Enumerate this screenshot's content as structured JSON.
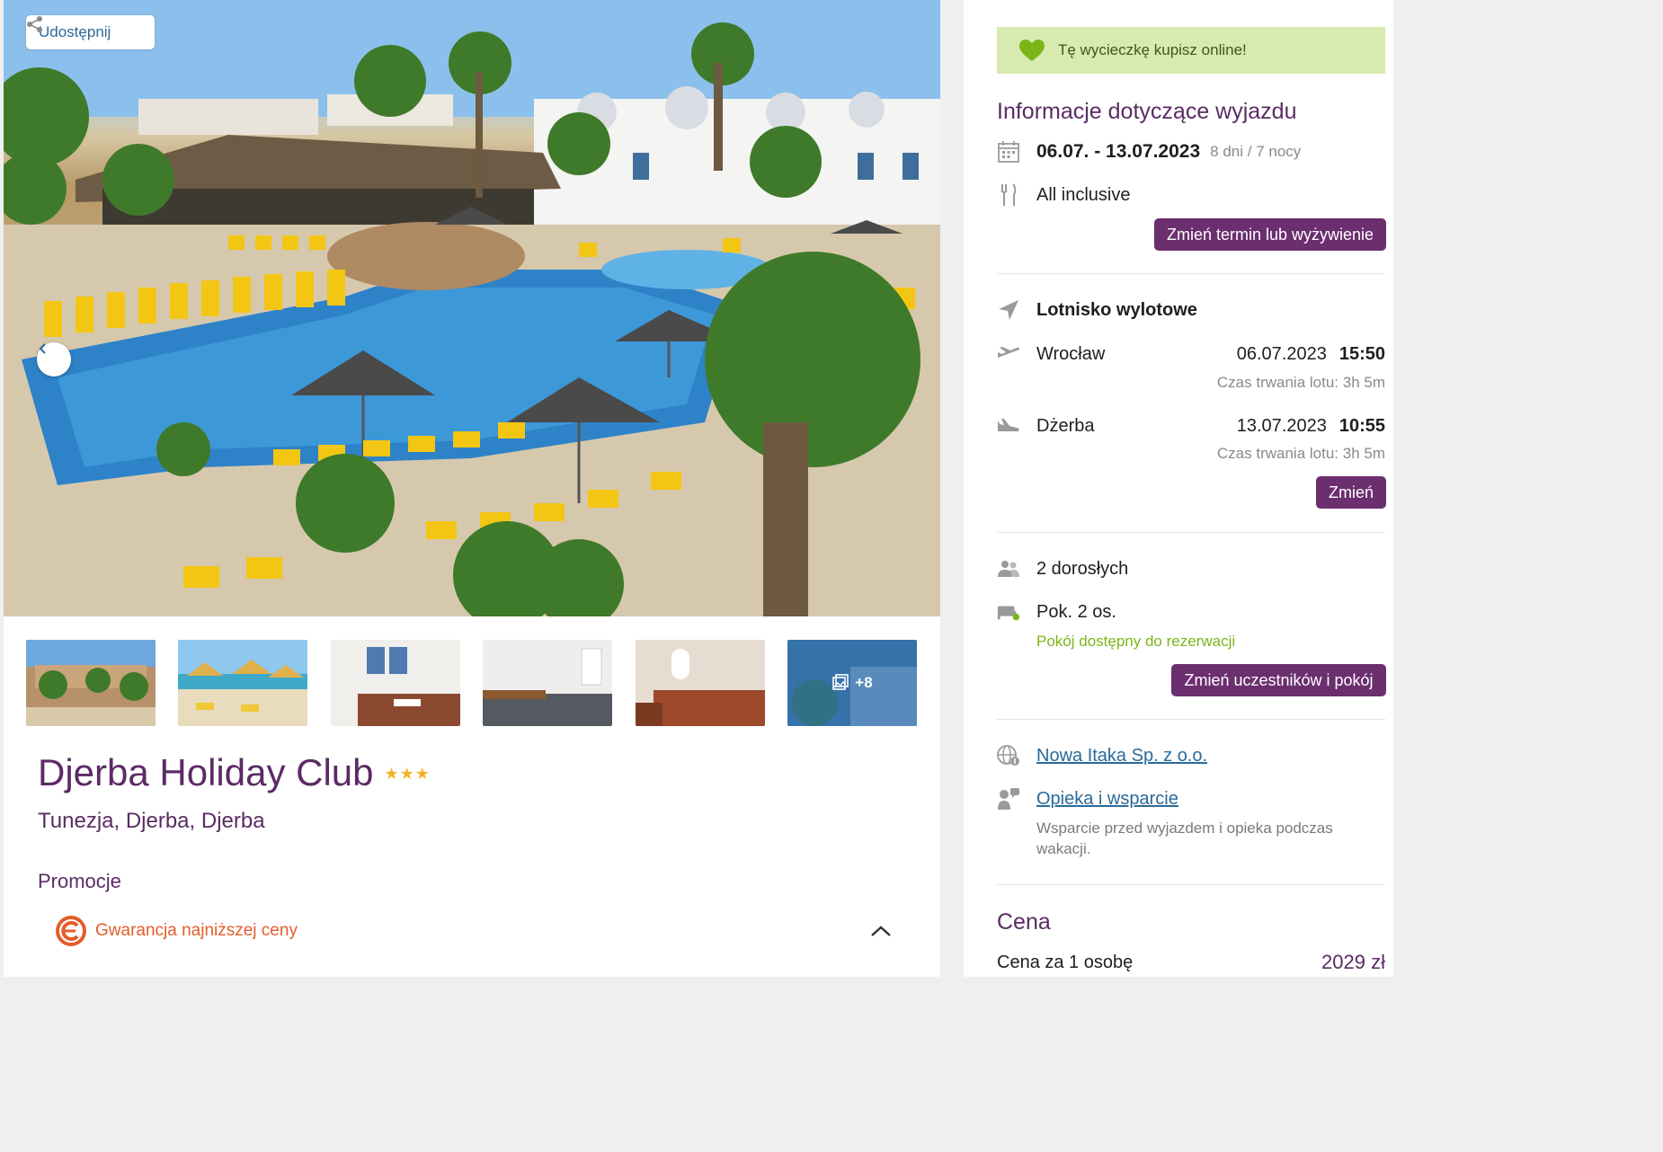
{
  "gallery": {
    "share_label": "Udostępnij",
    "more_count": "+8",
    "thumbnails": [
      "hotel-exterior",
      "beach-umbrellas",
      "room-1",
      "room-2",
      "room-3",
      "more-photos"
    ]
  },
  "hotel": {
    "name": "Djerba Holiday Club",
    "stars": "★★★",
    "location": "Tunezja, Djerba, Djerba"
  },
  "promotions": {
    "title": "Promocje",
    "items": [
      {
        "label": "Gwarancja najniższej ceny"
      }
    ]
  },
  "sidebar": {
    "online_banner": "Tę wycieczkę kupisz online!",
    "trip_info": {
      "title": "Informacje dotyczące wyjazdu",
      "dates": "06.07. - 13.07.2023",
      "duration": "8 dni / 7 nocy",
      "board": "All inclusive",
      "change_button": "Zmień termin lub wyżywienie"
    },
    "flights": {
      "title": "Lotnisko wylotowe",
      "outbound": {
        "city": "Wrocław",
        "date": "06.07.2023",
        "time": "15:50",
        "duration": "Czas trwania lotu: 3h 5m"
      },
      "return": {
        "city": "Dżerba",
        "date": "13.07.2023",
        "time": "10:55",
        "duration": "Czas trwania lotu: 3h 5m"
      },
      "change_button": "Zmień"
    },
    "participants": {
      "adults": "2 dorosłych",
      "room": "Pok. 2 os.",
      "availability": "Pokój dostępny do rezerwacji",
      "change_button": "Zmień uczestników i pokój"
    },
    "organizer": {
      "name": "Nowa Itaka Sp. z o.o.",
      "support_link": "Opieka i wsparcie",
      "support_desc": "Wsparcie przed wyjazdem i opieka podczas wakacji."
    },
    "price": {
      "title": "Cena",
      "per_person_label": "Cena za 1 osobę",
      "per_person_value": "2029 zł"
    }
  },
  "colors": {
    "brand_purple": "#6b2e6f",
    "title_purple": "#5b2b64",
    "banner_green": "#d7eab0",
    "available_green": "#7cb518",
    "promo_orange": "#e35d2c",
    "link_blue": "#2a6a9a"
  }
}
